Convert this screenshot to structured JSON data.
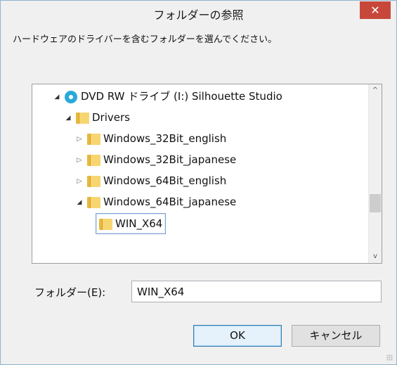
{
  "window": {
    "title": "フォルダーの参照",
    "close_glyph": "✕"
  },
  "instruction": "ハードウェアのドライバーを含むフォルダーを選んでください。",
  "tree": {
    "items": [
      {
        "label": "DVD RW ドライブ (I:) Silhouette Studio",
        "icon": "disc-icon",
        "arrow": "◢",
        "expanded": true
      },
      {
        "label": "Drivers",
        "icon": "folder-icon",
        "arrow": "◢",
        "expanded": true
      },
      {
        "label": "Windows_32Bit_english",
        "icon": "folder-icon",
        "arrow": "▷",
        "expanded": false
      },
      {
        "label": "Windows_32Bit_japanese",
        "icon": "folder-icon",
        "arrow": "▷",
        "expanded": false
      },
      {
        "label": "Windows_64Bit_english",
        "icon": "folder-icon",
        "arrow": "▷",
        "expanded": false
      },
      {
        "label": "Windows_64Bit_japanese",
        "icon": "folder-icon",
        "arrow": "◢",
        "expanded": true
      },
      {
        "label": "WIN_X64",
        "icon": "folder-icon",
        "arrow": "",
        "selected": true
      }
    ],
    "scroll_up": "^",
    "scroll_down": "v"
  },
  "folder_field": {
    "label": "フォルダー(E):",
    "value": "WIN_X64"
  },
  "buttons": {
    "ok": "OK",
    "cancel": "キャンセル"
  },
  "colors": {
    "close": "#c7483b",
    "selection_border": "#7da2ce",
    "folder": "#f7d672",
    "disc": "#29a9d9"
  }
}
